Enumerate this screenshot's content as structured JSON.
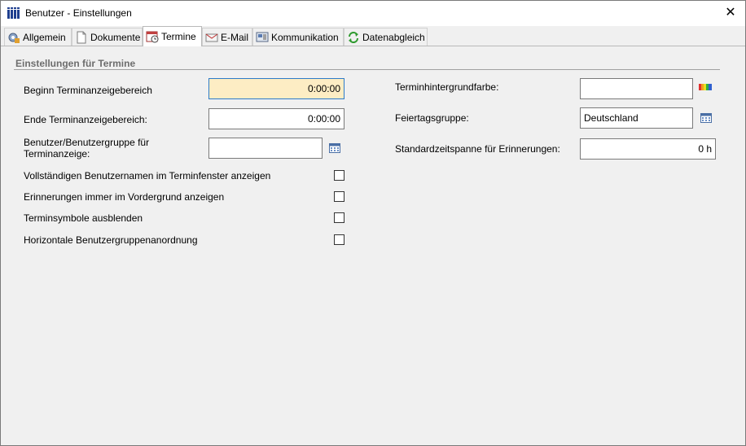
{
  "window": {
    "title": "Benutzer - Einstellungen"
  },
  "tabs": [
    {
      "label": "Allgemein",
      "icon": "gear-icon"
    },
    {
      "label": "Dokumente",
      "icon": "document-icon"
    },
    {
      "label": "Termine",
      "icon": "calendar-icon"
    },
    {
      "label": "E-Mail",
      "icon": "mail-icon"
    },
    {
      "label": "Kommunikation",
      "icon": "communication-icon"
    },
    {
      "label": "Datenabgleich",
      "icon": "sync-icon"
    }
  ],
  "active_tab": "Termine",
  "section": {
    "title": "Einstellungen für Termine"
  },
  "left": {
    "beginn": {
      "label": "Beginn Terminanzeigebereich",
      "value": "0:00:00"
    },
    "ende": {
      "label": "Ende Terminanzeigebereich:",
      "value": "0:00:00"
    },
    "benutzergruppe": {
      "label_line1": "Benutzer/Benutzergruppe für",
      "label_line2": "Terminanzeige:",
      "value": ""
    },
    "checks": [
      {
        "label": "Vollständigen Benutzernamen im Terminfenster anzeigen",
        "checked": false
      },
      {
        "label": "Erinnerungen immer im Vordergrund anzeigen",
        "checked": false
      },
      {
        "label": "Terminsymbole ausblenden",
        "checked": false
      },
      {
        "label": "Horizontale Benutzergruppenanordnung",
        "checked": false
      }
    ]
  },
  "right": {
    "hintergrundfarbe": {
      "label": "Terminhintergrundfarbe:",
      "value": ""
    },
    "feiertagsgruppe": {
      "label": "Feiertagsgruppe:",
      "value": "Deutschland"
    },
    "erinnerung": {
      "label": "Standardzeitspanne für Erinnerungen:",
      "value": "0 h"
    }
  },
  "colors": {
    "highlight_bg": "#fdedc4",
    "focus_border": "#2c7bc9",
    "section_title": "#6d6d6d"
  }
}
